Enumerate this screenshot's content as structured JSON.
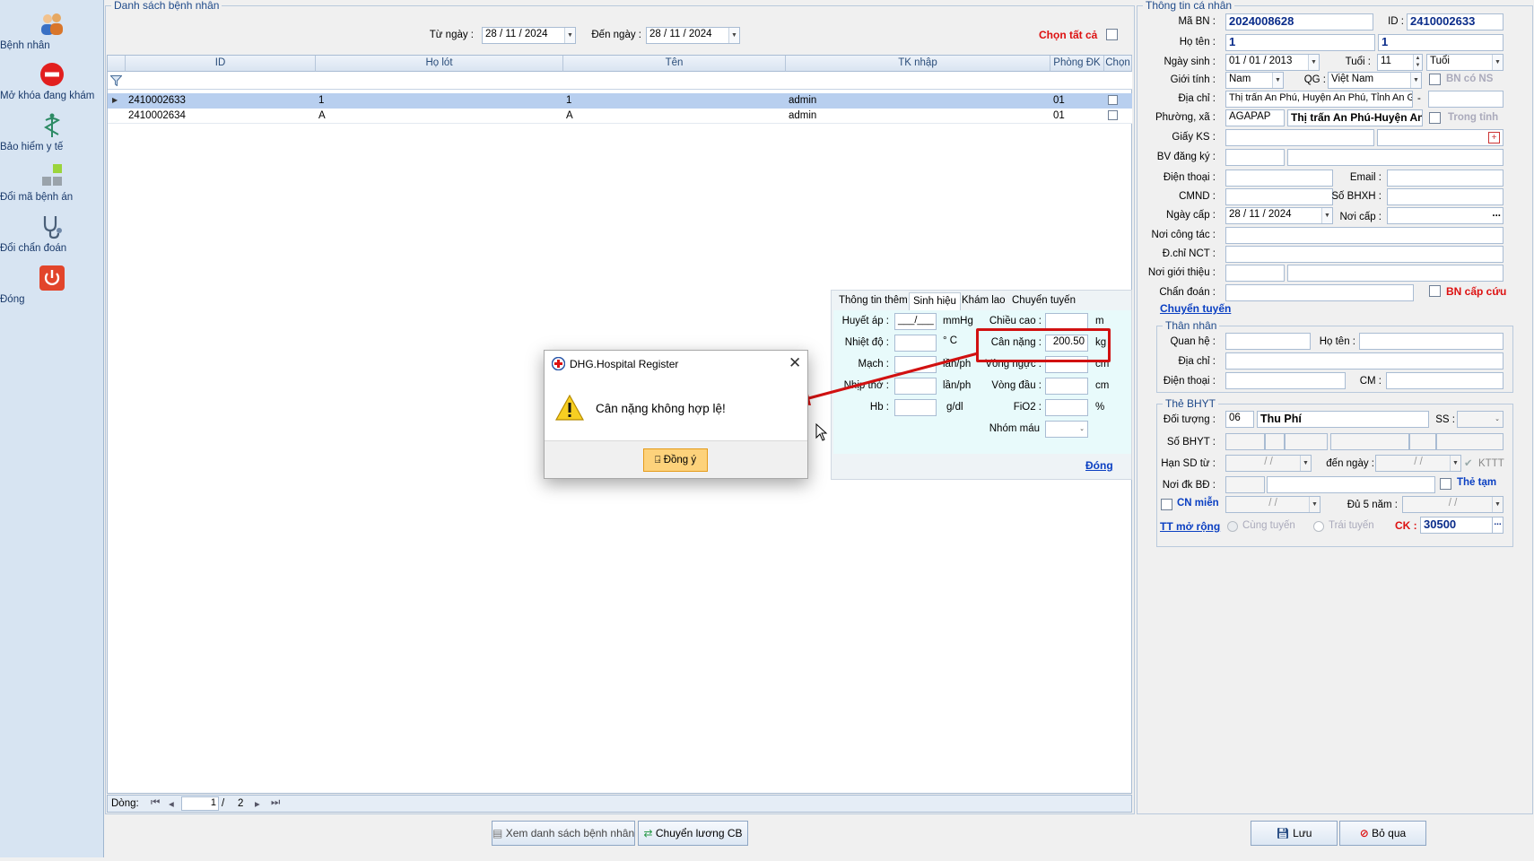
{
  "sidebar": {
    "items": [
      {
        "label": "Bệnh nhân",
        "icon": "patients-icon"
      },
      {
        "label": "Mở khóa đang khám",
        "icon": "unlock-no-entry-icon"
      },
      {
        "label": "Bảo hiểm y tế",
        "icon": "caduceus-icon"
      },
      {
        "label": "Đổi mã bệnh án",
        "icon": "blocks-icon"
      },
      {
        "label": "Đổi chẩn đoán",
        "icon": "stethoscope-icon"
      },
      {
        "label": "Đóng",
        "icon": "power-icon"
      }
    ]
  },
  "list": {
    "title": "Danh sách bệnh nhân",
    "from_label": "Từ ngày :",
    "from_date": "28 / 11 / 2024",
    "to_label": "Đến  ngày :",
    "to_date": "28 / 11 / 2024",
    "select_all": "Chọn tất cả",
    "columns": [
      "ID",
      "Họ lót",
      "Tên",
      "TK nhập",
      "Phòng ĐK",
      "Chọn"
    ],
    "rows": [
      {
        "id": "2410002633",
        "ho_lot": "1",
        "ten": "1",
        "tk_nhap": "admin",
        "phong": "01"
      },
      {
        "id": "2410002634",
        "ho_lot": "A",
        "ten": "A",
        "tk_nhap": "admin",
        "phong": "01"
      }
    ],
    "pager": {
      "label": "Dòng:",
      "current": "1",
      "separator": "/",
      "total": "2"
    }
  },
  "vitals": {
    "tabs": [
      "Thông tin thêm",
      "Sinh hiệu",
      "Khám lao",
      "Chuyển tuyến"
    ],
    "active_tab": "Sinh hiệu",
    "huyet_ap_label": "Huyết áp :",
    "huyet_ap_value": "___/___",
    "huyet_ap_unit": "mmHg",
    "chieu_cao_label": "Chiều cao :",
    "chieu_cao_unit": "m",
    "nhiet_do_label": "Nhiệt độ :",
    "nhiet_do_unit": "° C",
    "can_nang_label": "Cân nặng :",
    "can_nang_value": "200.50",
    "can_nang_unit": "kg",
    "mach_label": "Mạch :",
    "mach_unit": "lần/ph",
    "vong_nguc_label": "Vòng ngực :",
    "vong_nguc_unit": "cm",
    "nhip_tho_label": "Nhịp thở :",
    "nhip_tho_unit": "lần/ph",
    "vong_dau_label": "Vòng đầu :",
    "vong_dau_unit": "cm",
    "hb_label": "Hb :",
    "hb_unit": "g/dl",
    "fio2_label": "FiO2 :",
    "fio2_unit": "%",
    "nhom_mau_label": "Nhóm máu",
    "close_link": "Đóng"
  },
  "dialog": {
    "title": "DHG.Hospital Register",
    "message": "Cân nặng không hợp lệ!",
    "ok_label": "Đồng ý"
  },
  "personal": {
    "title": "Thông tin cá nhân",
    "ma_bn_label": "Mã BN :",
    "ma_bn": "2024008628",
    "id_label": "ID :",
    "id": "2410002633",
    "ho_ten_label": "Họ tên :",
    "ho_lot": "1",
    "ten": "1",
    "ngay_sinh_label": "Ngày sinh :",
    "ngay_sinh": "01 / 01 / 2013",
    "tuoi_label": "Tuổi :",
    "tuoi": "11",
    "tuoi_unit": "Tuổi",
    "gioi_tinh_label": "Giới tính :",
    "gioi_tinh": "Nam",
    "qg_label": "QG :",
    "qg": "Việt Nam",
    "bn_co_ns": "BN có NS",
    "dia_chi_label": "Địa chỉ :",
    "dia_chi": "Thị trấn An Phú, Huyện An Phú, Tỉnh An G",
    "dia_chi_dash": "-",
    "phuong_xa_label": "Phường, xã :",
    "phuong_xa_code": "AGAPAP",
    "phuong_xa_name": "Thị trấn An Phú-Huyện An",
    "trong_tinh": "Trong tỉnh",
    "giay_ks_label": "Giấy KS :",
    "bv_dang_ky_label": "BV đăng ký :",
    "dien_thoai_label": "Điện thoại :",
    "email_label": "Email :",
    "cmnd_label": "CMND :",
    "so_bhxh_label": "Số BHXH :",
    "ngay_cap_label": "Ngày cấp :",
    "ngay_cap": "28 / 11 / 2024",
    "noi_cap_label": "Nơi cấp :",
    "noi_cong_tac_label": "Nơi công tác :",
    "dchi_nct_label": "Đ.chỉ NCT :",
    "noi_gioi_thieu_label": "Nơi giới thiệu :",
    "chan_doan_label": "Chẩn đoán :",
    "bn_cap_cuu": "BN cấp cứu",
    "chuyen_tuyen_link": "Chuyển tuyến"
  },
  "relative": {
    "title": "Thân nhân",
    "quan_he_label": "Quan hệ :",
    "ho_ten_label": "Họ tên :",
    "dia_chi_label": "Địa chỉ :",
    "dien_thoai_label": "Điện thoại :",
    "cm_label": "CM :"
  },
  "bhyt": {
    "title": "Thẻ BHYT",
    "doi_tuong_label": "Đối tượng :",
    "doi_tuong_code": "06",
    "doi_tuong_name": "Thu Phí",
    "ss_label": "SS :",
    "so_bhyt_label": "Số BHYT :",
    "han_sd_label": "Hạn SD từ :",
    "han_sd_from": "/ /",
    "den_ngay_label": "đến  ngày :",
    "han_sd_to": "/ /",
    "kttt": "KTTT",
    "noi_dk_bd_label": "Nơi đk BĐ :",
    "the_tam": "Thẻ tạm",
    "cn_mien": "CN miễn",
    "cn_mien_date": "/ /",
    "du_5_nam_label": "Đủ 5 năm :",
    "du_5_nam_date": "/ /",
    "tt_mo_rong": "TT mở rộng",
    "cung_tuyen": "Cùng tuyến",
    "trai_tuyen": "Trái tuyến",
    "ck_label": "CK :",
    "ck_value": "30500"
  },
  "bottom": {
    "view_list": "Xem danh sách bệnh nhân",
    "chuyen_luong": "Chuyển lương CB",
    "save": "Lưu",
    "skip": "Bỏ qua"
  },
  "colors": {
    "accent_red": "#d11111",
    "link_blue": "#0a3fc2",
    "selected_row": "#b8cfef"
  }
}
